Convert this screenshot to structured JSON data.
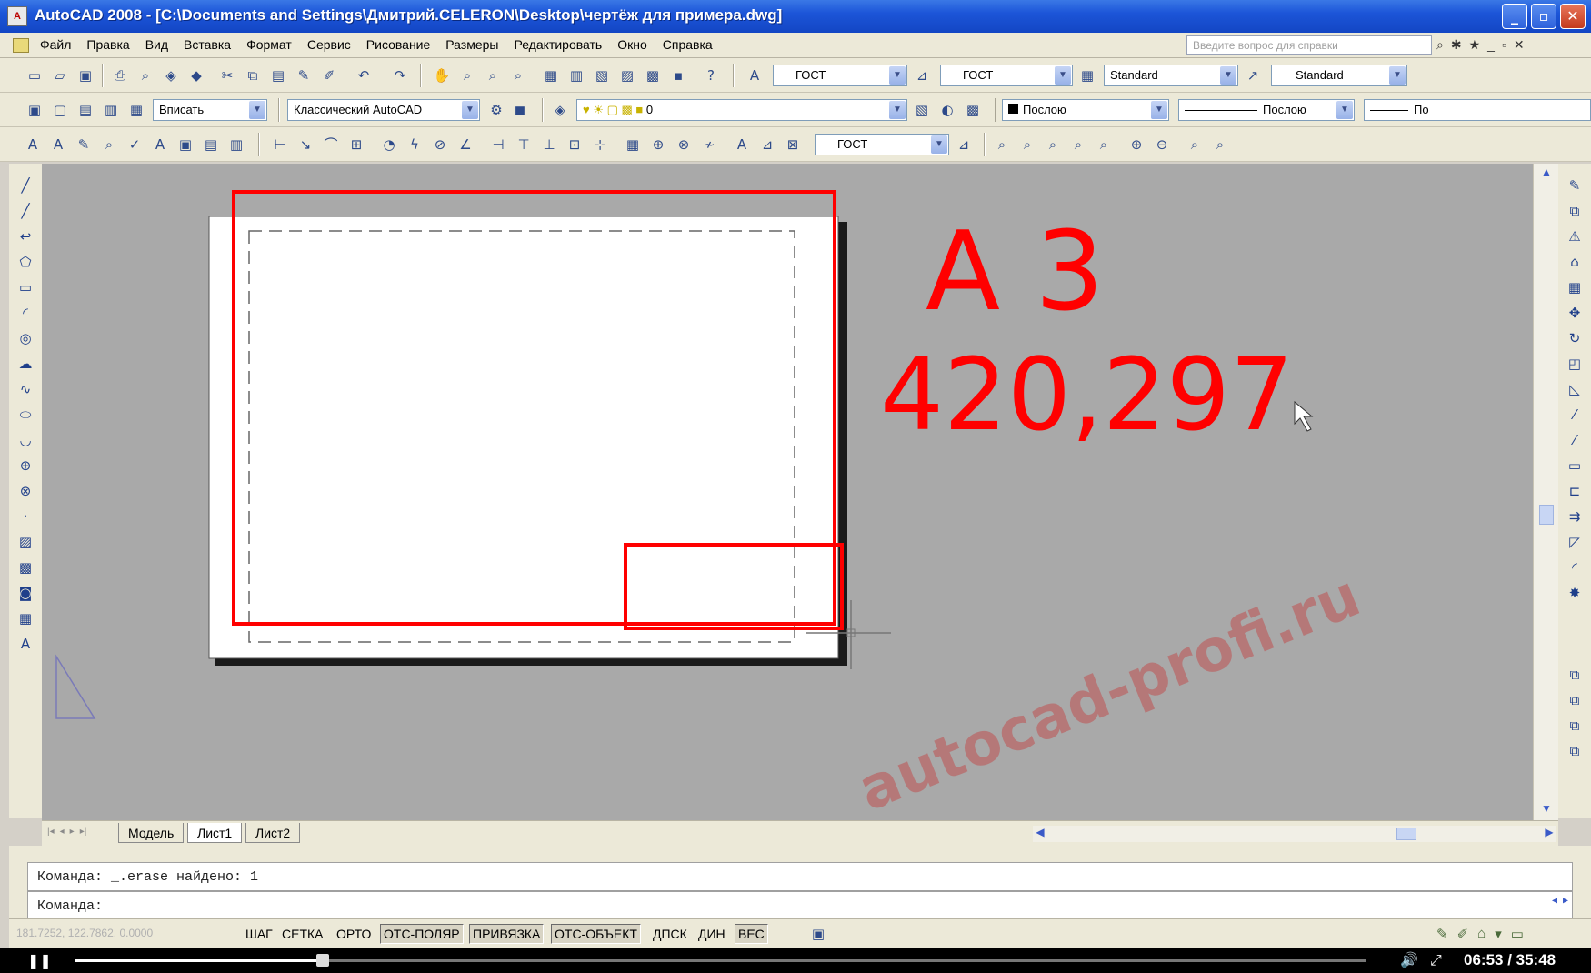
{
  "window": {
    "app_icon": "A",
    "title": "AutoCAD 2008 - [C:\\Documents and Settings\\Дмитрий.CELERON\\Desktop\\чертёж для примера.dwg]",
    "buttons": [
      "_",
      "▫",
      "✕"
    ]
  },
  "menu": {
    "items": [
      "Файл",
      "Правка",
      "Вид",
      "Вставка",
      "Формат",
      "Сервис",
      "Рисование",
      "Размеры",
      "Редактировать",
      "Окно",
      "Справка"
    ],
    "help_placeholder": "Введите вопрос для справки",
    "right_icons": [
      "⌕",
      "✱",
      "★",
      "_",
      "▫",
      "✕"
    ]
  },
  "toolbars": {
    "text_style": "ГОСТ",
    "dim_style": "ГОСТ",
    "table_style": "Standard",
    "mleader_style": "Standard",
    "viewport_scale": "Вписать",
    "workspace": "Классический AutoCAD",
    "layer": "0",
    "color": "Послою",
    "linetype": "Послою",
    "lineweight": "По",
    "dim_style2": "ГОСТ"
  },
  "drawing": {
    "annotation_format": "А 3",
    "annotation_size": "420,297",
    "watermark": "autocad-profi.ru",
    "annotation_color": "#ff0000"
  },
  "tabs": {
    "nav": [
      "|◂",
      "◂",
      "▸",
      "▸|"
    ],
    "items": [
      "Модель",
      "Лист1",
      "Лист2"
    ],
    "active": "Лист1"
  },
  "command": {
    "line1": "Команда: _.erase найдено: 1",
    "line2": "Команда:"
  },
  "status": {
    "coords": "181.7252, 122.7862, 0.0000",
    "buttons": [
      "ШАГ",
      "СЕТКА",
      "ОРТО",
      "ОТС-ПОЛЯР",
      "ПРИВЯЗКА",
      "ОТС-ОБЪЕКТ",
      "ДПСК",
      "ДИН",
      "ВЕС"
    ],
    "active": [
      "ОТС-ПОЛЯР",
      "ПРИВЯЗКА",
      "ОТС-ОБЪЕКТ",
      "ВЕС"
    ]
  },
  "player": {
    "time": "06:53 / 35:48",
    "progress": 0.192
  }
}
